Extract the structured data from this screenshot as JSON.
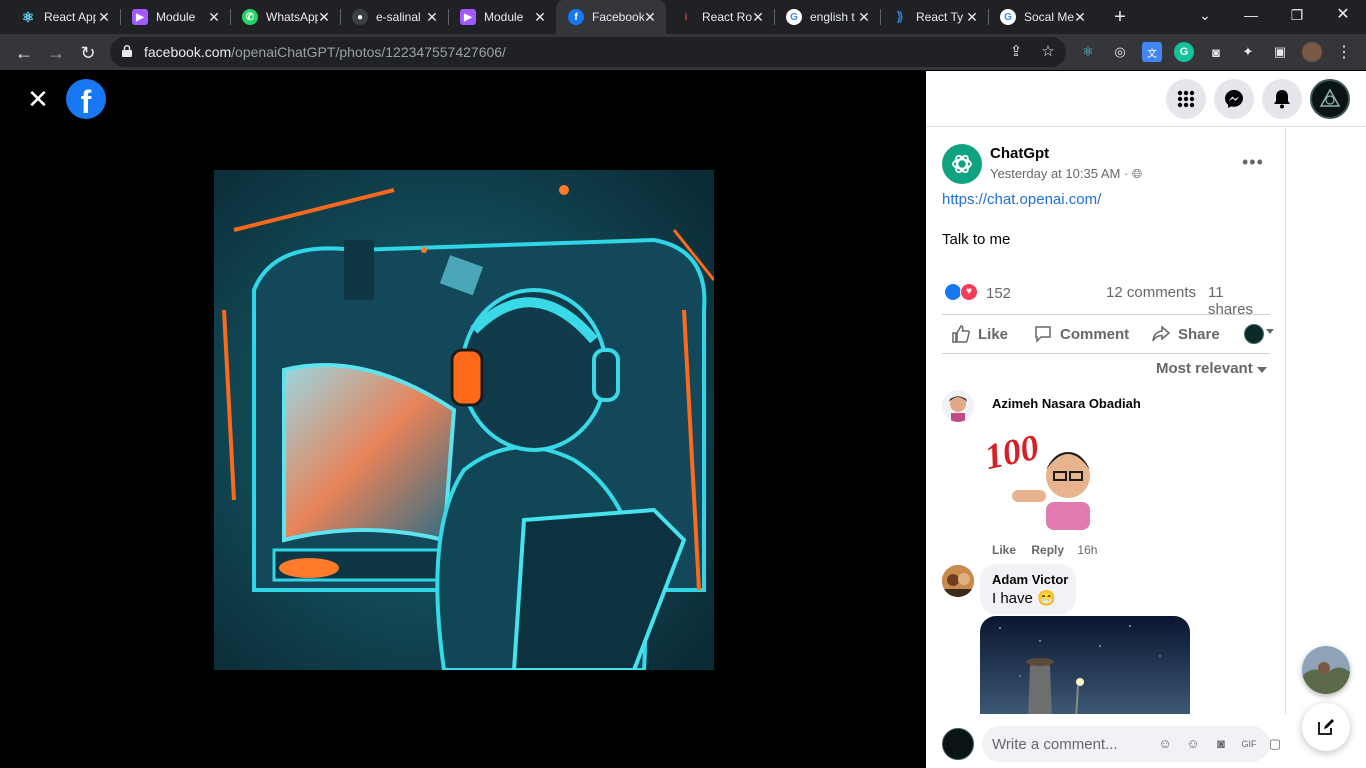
{
  "browser": {
    "tabs": [
      {
        "label": "React App",
        "icon": "react-icon",
        "color": "#61dafb"
      },
      {
        "label": "Module",
        "icon": "module-icon",
        "color": "#a259ff"
      },
      {
        "label": "WhatsApp",
        "icon": "whatsapp-icon",
        "color": "#25d366"
      },
      {
        "label": "e-salinal",
        "icon": "github-icon",
        "color": "#e8eaed"
      },
      {
        "label": "Module",
        "icon": "module-icon",
        "color": "#a259ff"
      },
      {
        "label": "Facebook",
        "icon": "facebook-icon",
        "color": "#1877f2"
      },
      {
        "label": "React Ro",
        "icon": "reactrouter-icon",
        "color": "#ca4245"
      },
      {
        "label": "english t",
        "icon": "google-icon",
        "color": "#4285f4"
      },
      {
        "label": "React Ty",
        "icon": "react-ts-icon",
        "color": "#3178c6"
      },
      {
        "label": "Socal Me",
        "icon": "google-icon",
        "color": "#4285f4"
      }
    ],
    "url_host": "facebook.com",
    "url_path": "/openaiChatGPT/photos/122347557427606/"
  },
  "post": {
    "author": "ChatGpt",
    "meta": "Yesterday at 10:35 AM ·",
    "link": "https://chat.openai.com/",
    "text": "Talk to me",
    "reaction_count": "152",
    "comments": "12 comments",
    "shares": "11 shares",
    "actions": {
      "like": "Like",
      "comment": "Comment",
      "share": "Share"
    },
    "sort": "Most relevant"
  },
  "comments": [
    {
      "author": "Azimeh Nasara Obadiah",
      "sticker_text": "100",
      "like": "Like",
      "reply": "Reply",
      "time": "16h"
    },
    {
      "author": "Adam Victor",
      "text": "I have 😁"
    }
  ],
  "composer": {
    "placeholder": "Write a comment..."
  },
  "colors": {
    "facebook_blue": "#1877f2",
    "link": "#216fdb",
    "love": "#f33e58",
    "chatgpt_green": "#10a37f"
  }
}
